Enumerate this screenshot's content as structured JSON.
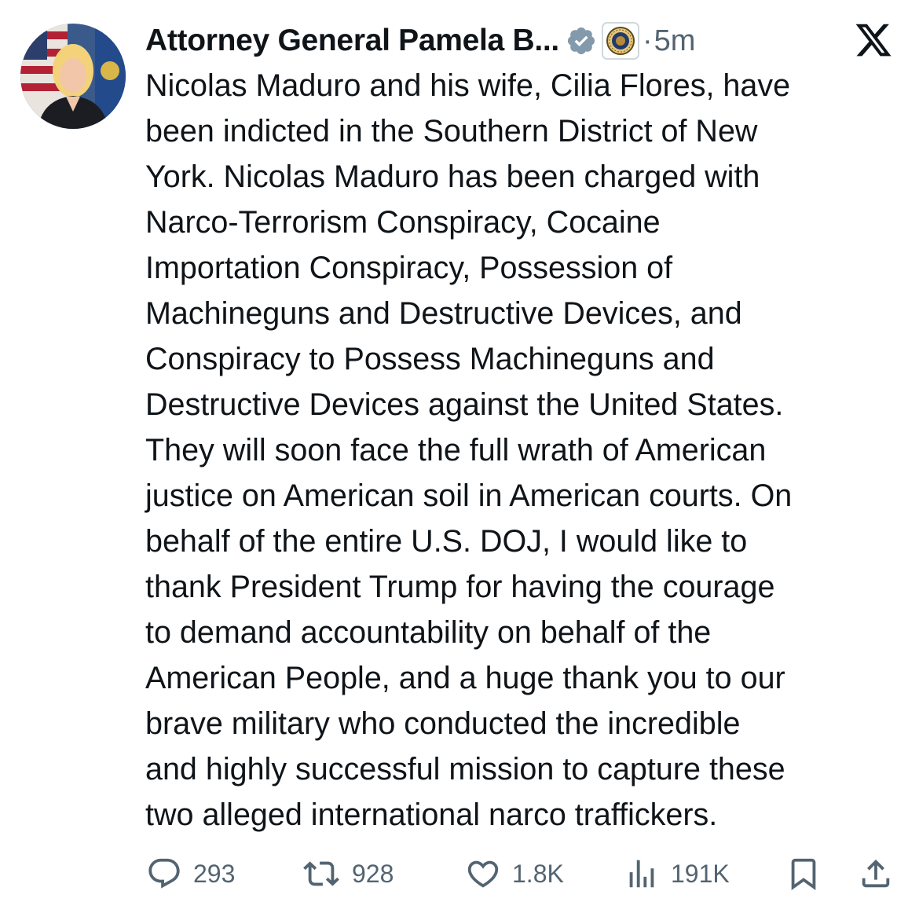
{
  "author": {
    "display_name": "Attorney General Pamela B...",
    "verified_icon": "verified-badge-icon",
    "affiliate_icon": "doj-seal-icon",
    "separator": "·",
    "timestamp": "5m"
  },
  "platform_icon": "x-logo-icon",
  "post": {
    "lines": [
      "Nicolas Maduro and his wife, Cilia Flores, have",
      "been indicted in the Southern District of New",
      "York.  Nicolas Maduro has been charged with",
      "Narco-Terrorism Conspiracy, Cocaine",
      "Importation Conspiracy, Possession of",
      "Machineguns and Destructive Devices, and",
      "Conspiracy to Possess Machineguns and",
      "Destructive Devices against the United States.",
      "They will soon face the full wrath of American",
      "justice on American soil in American courts. On",
      "behalf of the entire U.S. DOJ, I would like to",
      "thank President Trump for having the courage",
      "to demand accountability on behalf of the",
      "American People, and a huge thank you to our",
      "brave military who conducted the incredible",
      "and highly successful mission to capture these",
      "two alleged international narco traffickers."
    ]
  },
  "actions": {
    "replies": "293",
    "reposts": "928",
    "likes": "1.8K",
    "views": "191K"
  },
  "colors": {
    "text": "#0f1419",
    "secondary": "#536471",
    "verified_badge": "#829aab"
  }
}
